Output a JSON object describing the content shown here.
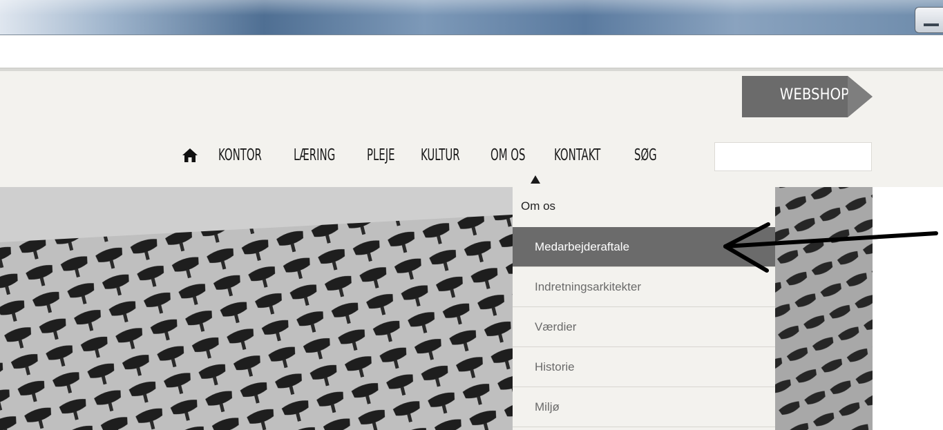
{
  "header": {
    "webshop_label": "WEBSHOP",
    "nav": [
      "KONTOR",
      "LÆRING",
      "PLEJE",
      "KULTUR",
      "OM OS",
      "KONTAKT",
      "SØG"
    ],
    "search_value": ""
  },
  "dropdown": {
    "heading": "Om os",
    "items": [
      "Medarbejderaftale",
      "Indretningsarkitekter",
      "Værdier",
      "Historie",
      "Miljø"
    ],
    "active_item": "Medarbejderaftale"
  },
  "icons": {
    "home": "home-icon",
    "caret": "caret-up-icon",
    "minimize": "minimize-icon",
    "annotation": "arrow-icon"
  },
  "colors": {
    "header_bg": "#f3f2ee",
    "webshop_bg": "#6b6b6b",
    "active_item_bg": "#6b6b6b",
    "text": "#1a1a1a"
  }
}
